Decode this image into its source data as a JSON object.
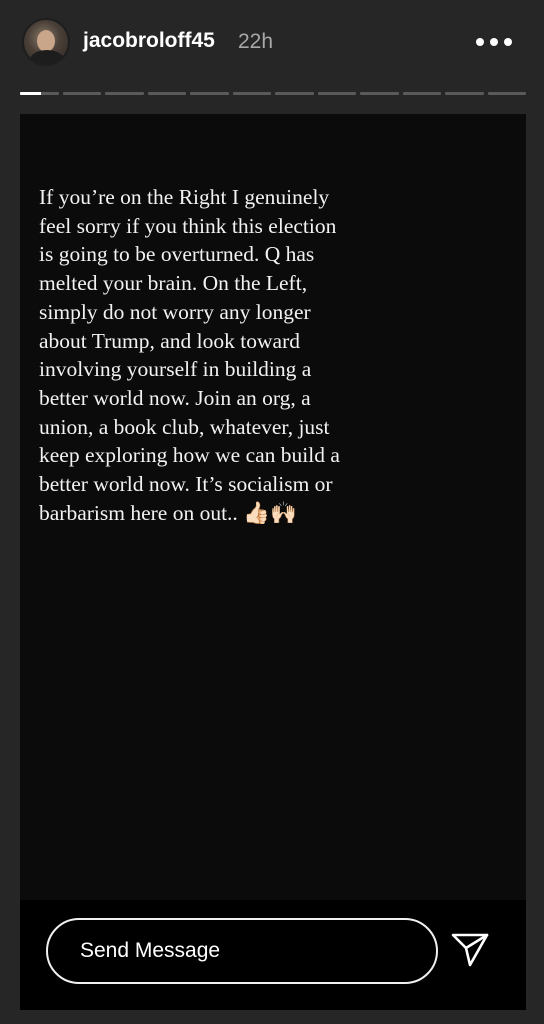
{
  "header": {
    "username": "jacobroloff45",
    "timestamp": "22h",
    "avatar_icon": "profile-photo",
    "more_icon": "more-horizontal-icon"
  },
  "progress": {
    "segment_count": 12,
    "current_index": 1,
    "current_fraction": 0.55
  },
  "story": {
    "background_color": "#0c0b0b",
    "text_lines": [
      "If you’re on the Right I genuinely",
      "feel sorry if you think this election",
      "is going to be overturned. Q has",
      "melted your brain. On the Left,",
      "simply do not worry any longer",
      "about Trump, and look toward",
      "involving yourself in building a",
      "better world now. Join an org, a",
      "union, a book club, whatever, just",
      "keep exploring how we can build a",
      "better world now. It’s socialism or",
      "barbarism here on out.. 👍🏻🙌🏻"
    ]
  },
  "reply": {
    "placeholder": "Send Message",
    "send_icon": "paper-plane-icon"
  }
}
